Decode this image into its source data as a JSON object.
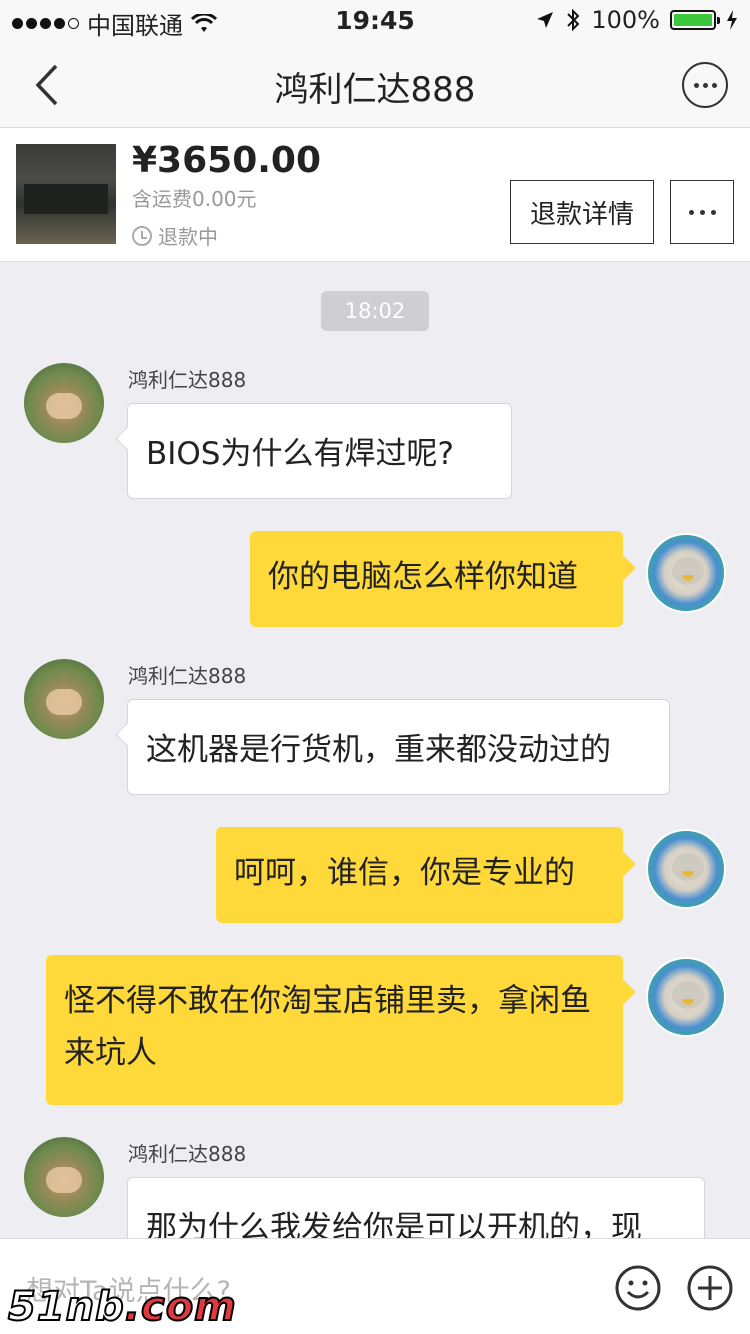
{
  "status_bar": {
    "carrier": "中国联通",
    "time": "19:45",
    "battery": "100%",
    "battery_level": 1.0
  },
  "nav": {
    "title": "鸿利仁达888"
  },
  "product": {
    "price": "¥3650.00",
    "shipping": "含运费0.00元",
    "status": "退款中",
    "refund_button": "退款详情"
  },
  "chat": {
    "time_chip": "18:02",
    "messages": [
      {
        "sender": "鸿利仁达888",
        "text": "BIOS为什么有焊过呢?"
      },
      {
        "text": "你的电脑怎么样你知道"
      },
      {
        "sender": "鸿利仁达888",
        "text": "这机器是行货机，重来都没动过的"
      },
      {
        "text": "呵呵，谁信，你是专业的"
      },
      {
        "text": "怪不得不敢在你淘宝店铺里卖，拿闲鱼来坑人"
      },
      {
        "sender": "鸿利仁达888",
        "text": "那为什么我发给你是可以开机的，现"
      }
    ]
  },
  "input": {
    "placeholder": "想对Ta说点什么?"
  },
  "watermark": {
    "prefix": "51nb",
    "suffix": ".com"
  },
  "colors": {
    "outgoing_bubble": "#ffd83a",
    "incoming_bubble": "#ffffff",
    "background": "#eeeef2"
  }
}
